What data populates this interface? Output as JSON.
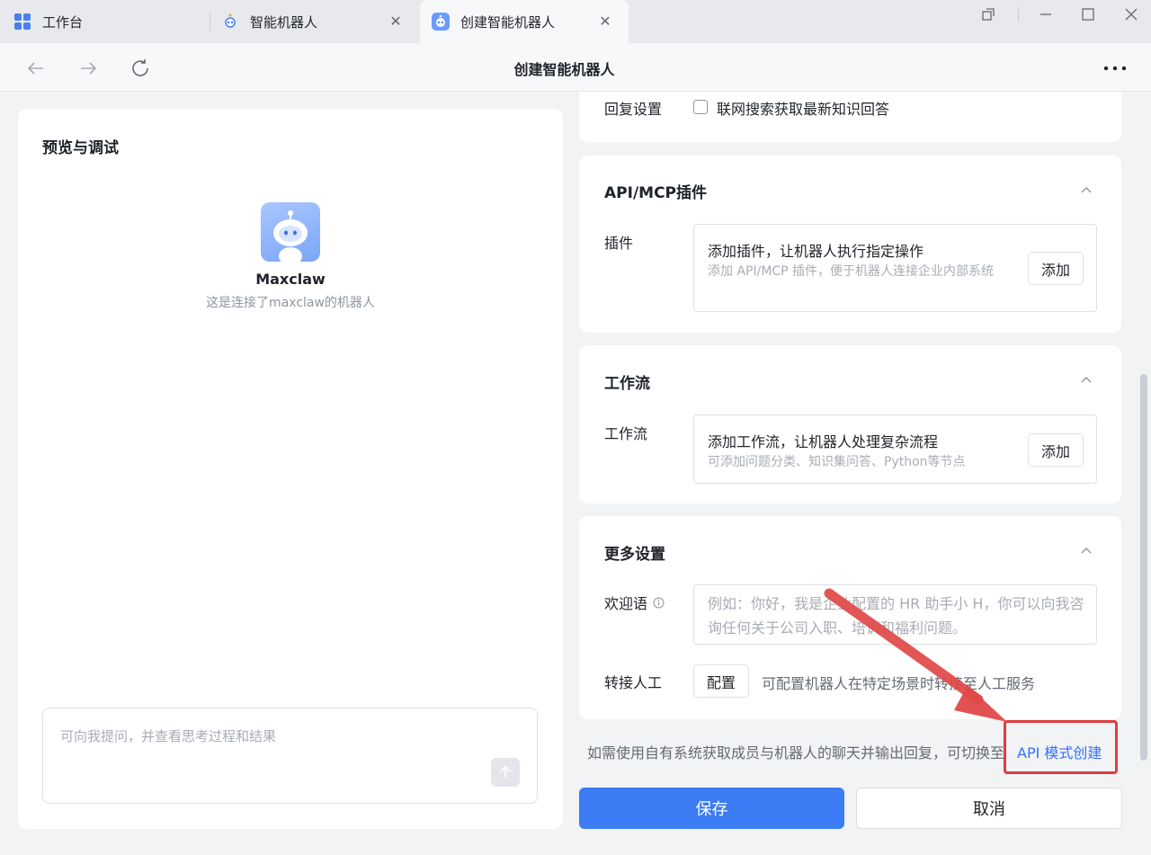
{
  "tabs": [
    {
      "label": "工作台",
      "icon": "grid-app-icon",
      "closable": false
    },
    {
      "label": "智能机器人",
      "icon": "robot-icon",
      "closable": true
    },
    {
      "label": "创建智能机器人",
      "icon": "robot-icon",
      "closable": true,
      "active": true
    }
  ],
  "nav": {
    "title": "创建智能机器人"
  },
  "preview": {
    "title": "预览与调试",
    "bot_name": "Maxclaw",
    "bot_desc": "这是连接了maxclaw的机器人",
    "input_placeholder": "可向我提问，并查看思考过程和结果"
  },
  "partial_top": {
    "label": "回复设置",
    "option": "联网搜索获取最新知识回答"
  },
  "plugin_card": {
    "title": "API/MCP插件",
    "field_label": "插件",
    "main": "添加插件，让机器人执行指定操作",
    "sub": "添加 API/MCP 插件，便于机器人连接企业内部系统",
    "button": "添加"
  },
  "workflow_card": {
    "title": "工作流",
    "field_label": "工作流",
    "main": "添加工作流，让机器人处理复杂流程",
    "sub": "可添加问题分类、知识集问答、Python等节点",
    "button": "添加"
  },
  "more_card": {
    "title": "更多设置",
    "welcome_label": "欢迎语",
    "welcome_placeholder": "例如：你好，我是企业配置的 HR 助手小 H，你可以向我咨询任何关于公司入职、培训和福利问题。",
    "transfer_label": "转接人工",
    "transfer_button": "配置",
    "transfer_desc": "可配置机器人在特定场景时转接至人工服务"
  },
  "api_tip": {
    "text": "如需使用自有系统获取成员与机器人的聊天并输出回复，可切换至",
    "link": "API 模式创建"
  },
  "actions": {
    "save": "保存",
    "cancel": "取消"
  },
  "colors": {
    "primary": "#3b7bf3",
    "link": "#3370ff",
    "annotation": "#e03d3d"
  }
}
